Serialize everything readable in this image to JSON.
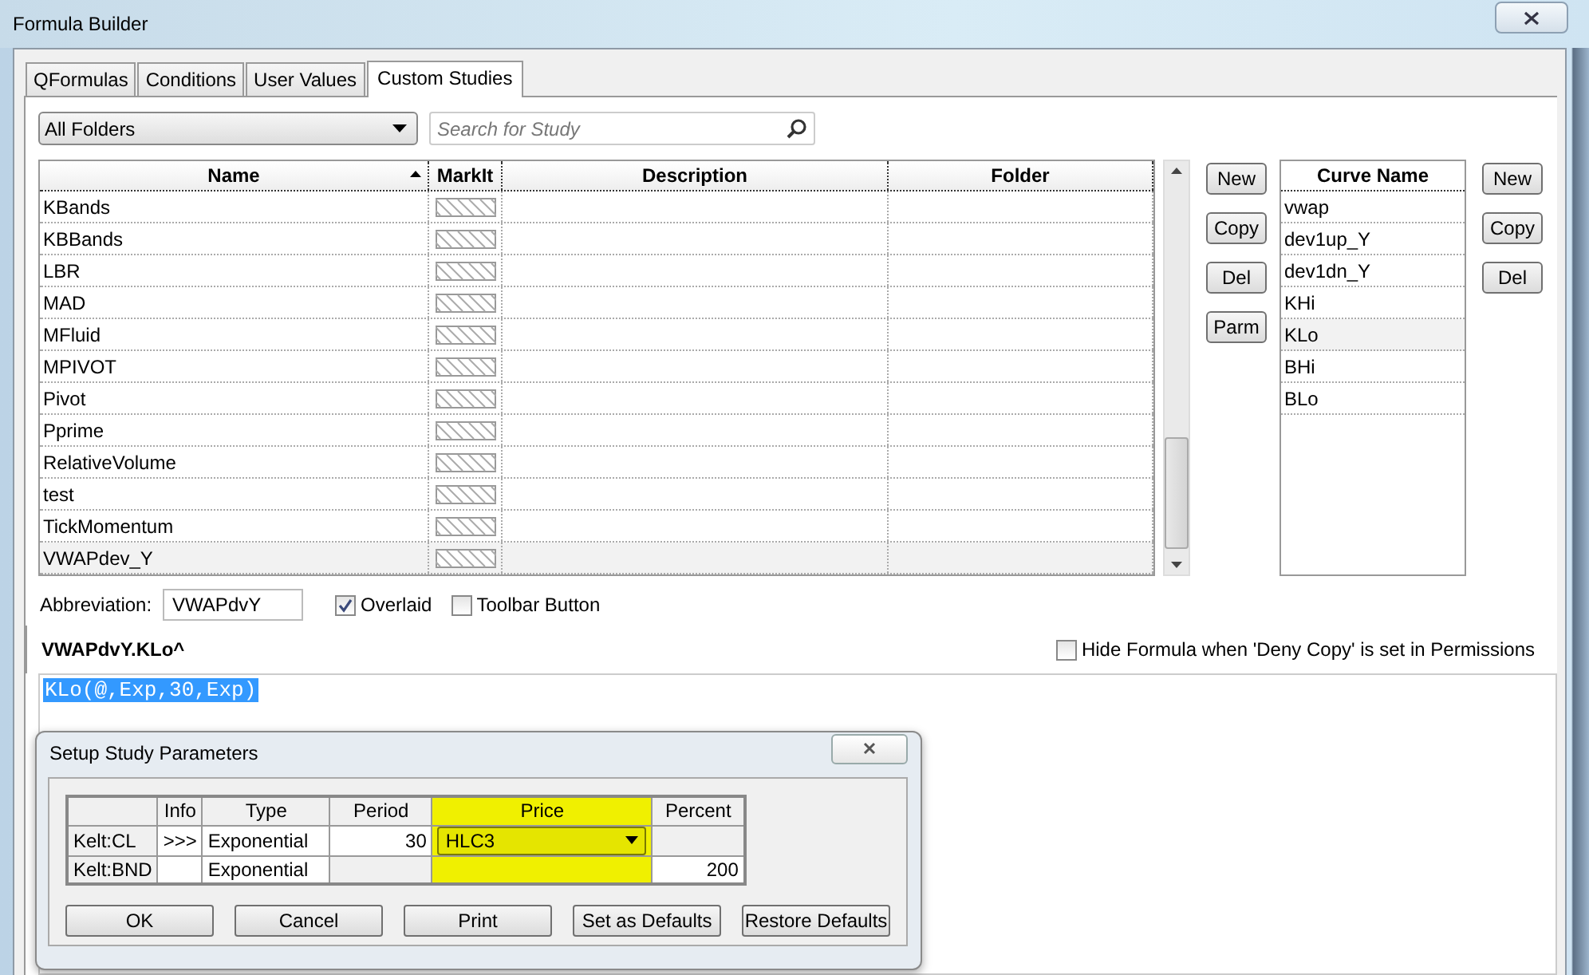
{
  "window": {
    "title": "Formula Builder"
  },
  "tabs": [
    {
      "label": "QFormulas",
      "selected": false
    },
    {
      "label": "Conditions",
      "selected": false
    },
    {
      "label": "User Values",
      "selected": false
    },
    {
      "label": "Custom Studies",
      "selected": true
    }
  ],
  "folder_dropdown": {
    "value": "All Folders"
  },
  "search": {
    "placeholder": "Search for Study"
  },
  "studies": {
    "columns": [
      "Name",
      "MarkIt",
      "Description",
      "Folder"
    ],
    "rows": [
      {
        "name": "KBands",
        "selected": false
      },
      {
        "name": "KBBands",
        "selected": false
      },
      {
        "name": "LBR",
        "selected": false
      },
      {
        "name": "MAD",
        "selected": false
      },
      {
        "name": "MFluid",
        "selected": false
      },
      {
        "name": "MPIVOT",
        "selected": false
      },
      {
        "name": "Pivot",
        "selected": false
      },
      {
        "name": "Pprime",
        "selected": false
      },
      {
        "name": "RelativeVolume",
        "selected": false
      },
      {
        "name": "test",
        "selected": false
      },
      {
        "name": "TickMomentum",
        "selected": false
      },
      {
        "name": "VWAPdev_Y",
        "selected": true
      }
    ]
  },
  "study_buttons": [
    "New",
    "Copy",
    "Del",
    "Parm"
  ],
  "curves": {
    "column": "Curve Name",
    "rows": [
      {
        "name": "vwap",
        "selected": false
      },
      {
        "name": "dev1up_Y",
        "selected": false
      },
      {
        "name": "dev1dn_Y",
        "selected": false
      },
      {
        "name": "KHi",
        "selected": false
      },
      {
        "name": "KLo",
        "selected": true
      },
      {
        "name": "BHi",
        "selected": false
      },
      {
        "name": "BLo",
        "selected": false
      }
    ]
  },
  "curve_buttons": [
    "New",
    "Copy",
    "Del"
  ],
  "abbreviation": {
    "label": "Abbreviation:",
    "value": "VWAPdvY"
  },
  "options": [
    {
      "label": "Overlaid",
      "checked": true
    },
    {
      "label": "Toolbar Button",
      "checked": false
    }
  ],
  "formula_title": "VWAPdvY.KLo^",
  "hide_formula": {
    "label": "Hide Formula when 'Deny Copy' is set in Permissions",
    "checked": false
  },
  "formula": {
    "text": "KLo(@,Exp,30,Exp)",
    "selected": true
  },
  "dialog": {
    "title": "Setup Study Parameters",
    "columns": [
      {
        "label": "Info",
        "kind": "text",
        "highlight": false
      },
      {
        "label": "Type",
        "kind": "text",
        "highlight": false
      },
      {
        "label": "Period",
        "kind": "number",
        "highlight": false
      },
      {
        "label": "Price",
        "kind": "text",
        "highlight": true
      },
      {
        "label": "Percent",
        "kind": "number",
        "highlight": false
      }
    ],
    "rows": [
      {
        "label": "Kelt:CL",
        "cells": [
          {
            "text": ">>>",
            "disabled": false
          },
          {
            "text": "Exponential",
            "disabled": false
          },
          {
            "text": "30",
            "disabled": false
          },
          {
            "text": "HLC3",
            "kind": "dropdown",
            "disabled": false
          },
          {
            "disabled": true
          }
        ]
      },
      {
        "label": "Kelt:BND",
        "cells": [
          {
            "disabled": false
          },
          {
            "text": "Exponential",
            "disabled": false
          },
          {
            "disabled": true
          },
          {
            "disabled": true
          },
          {
            "text": "200",
            "disabled": false
          }
        ]
      }
    ],
    "buttons": [
      "OK",
      "Cancel",
      "Print",
      "Set as Defaults",
      "Restore Defaults"
    ]
  }
}
